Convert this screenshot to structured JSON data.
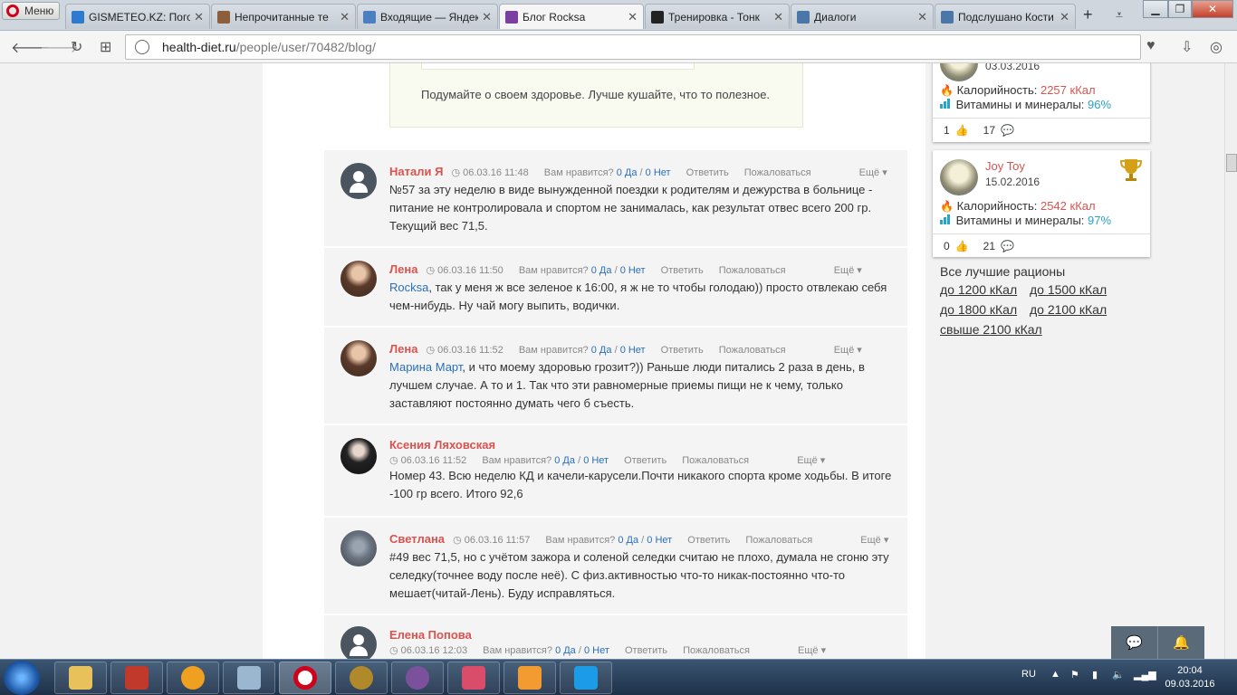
{
  "browser": {
    "menu_label": "Меню",
    "tabs": [
      {
        "title": "GISMETEO.KZ: Пого",
        "color": "#2f7ad1"
      },
      {
        "title": "Непрочитанные те",
        "color": "#8b5e3c"
      },
      {
        "title": "Входящие — Яндек",
        "color": "#4a7fc1"
      },
      {
        "title": "Блог Rocksa",
        "color": "#7a3fa0"
      },
      {
        "title": "Тренировка - Тонк",
        "color": "#222222"
      },
      {
        "title": "Диалоги",
        "color": "#4a76a8"
      },
      {
        "title": "Подслушано Кости",
        "color": "#4a76a8"
      }
    ],
    "active_tab": 3,
    "url_host": "health-diet.ru",
    "url_path": "/people/user/70482/blog/"
  },
  "quote": {
    "text": "Подумайте о своем здоровье. Лучше кушайте, что то полезное."
  },
  "comments": [
    {
      "author": "Натали Я",
      "time": "06.03.16 11:48",
      "like_q": "Вам нравится?",
      "yes": "0 Да",
      "sep": "/",
      "no": "0 Нет",
      "reply": "Ответить",
      "report": "Пожаловаться",
      "more": "Ещё",
      "mention": "",
      "text": "№57 за эту неделю в виде вынужденной поездки к родителям и дежурства в больнице - питание не контролировала и спортом не занималась, как результат отвес всего 200 гр. Текущий вес 71,5."
    },
    {
      "author": "Лена",
      "time": "06.03.16 11:50",
      "like_q": "Вам нравится?",
      "yes": "0 Да",
      "sep": "/",
      "no": "0 Нет",
      "reply": "Ответить",
      "report": "Пожаловаться",
      "more": "Ещё",
      "mention": "Rocksa",
      "text": ", так у меня ж все зеленое к 16:00, я ж не то чтобы голодаю)) просто отвлекаю себя чем-нибудь. Ну чай могу выпить, водички."
    },
    {
      "author": "Лена",
      "time": "06.03.16 11:52",
      "like_q": "Вам нравится?",
      "yes": "0 Да",
      "sep": "/",
      "no": "0 Нет",
      "reply": "Ответить",
      "report": "Пожаловаться",
      "more": "Ещё",
      "mention": "Марина Март",
      "text": ", и что моему здоровью грозит?)) Раньше люди питались 2 раза в день, в лучшем случае. А то и 1. Так что эти равномерные приемы пищи не к чему, только заставляют постоянно думать чего б съесть."
    },
    {
      "author": "Ксения Ляховская",
      "time": "06.03.16 11:52",
      "like_q": "Вам нравится?",
      "yes": "0 Да",
      "sep": "/",
      "no": "0 Нет",
      "reply": "Ответить",
      "report": "Пожаловаться",
      "more": "Ещё",
      "mention": "",
      "text": "Номер 43. Всю неделю КД и качели-карусели.Почти никакого спорта кроме ходьбы. В итоге -100 гр всего. Итого 92,6"
    },
    {
      "author": "Светлана",
      "time": "06.03.16 11:57",
      "like_q": "Вам нравится?",
      "yes": "0 Да",
      "sep": "/",
      "no": "0 Нет",
      "reply": "Ответить",
      "report": "Пожаловаться",
      "more": "Ещё",
      "mention": "",
      "text": "#49 вес 71,5, но с учётом зажора и соленой селедки считаю не плохо, думала не сгоню эту селедку(точнее воду после неё). С физ.активностью что-то никак-постоянно что-то мешает(читай-Лень). Буду исправляться."
    },
    {
      "author": "Елена Попова",
      "time": "06.03.16 12:03",
      "like_q": "Вам нравится?",
      "yes": "0 Да",
      "sep": "/",
      "no": "0 Нет",
      "reply": "Ответить",
      "report": "Пожаловаться",
      "more": "Ещё",
      "mention": "",
      "text": ""
    }
  ],
  "sidebar": {
    "cards": [
      {
        "name": "",
        "date": "03.03.2016",
        "cal_label": "Калорийность:",
        "cal_value": "2257 кКал",
        "vit_label": "Витамины и минералы:",
        "vit_value": "96%",
        "likes": "1",
        "comments": "17"
      },
      {
        "name": "Joy Toy",
        "date": "15.02.2016",
        "cal_label": "Калорийность:",
        "cal_value": "2542 кКал",
        "vit_label": "Витамины и минералы:",
        "vit_value": "97%",
        "likes": "0",
        "comments": "21"
      }
    ],
    "best_title": "Все лучшие рационы",
    "best_links": [
      "до 1200 кКал",
      "до 1500 кКал",
      "до 1800 кКал",
      "до 2100 кКал",
      "свыше 2100 кКал"
    ]
  },
  "taskbar": {
    "lang": "RU",
    "time": "20:04",
    "date": "09.03.2016"
  }
}
